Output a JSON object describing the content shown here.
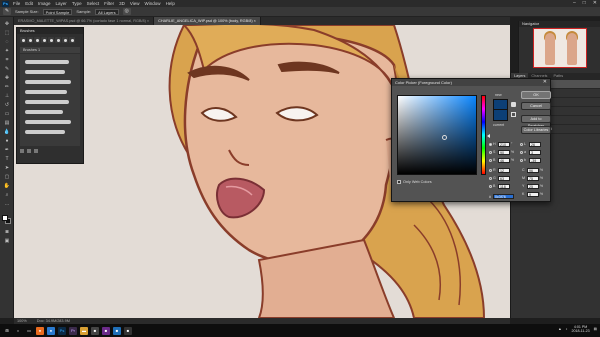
{
  "menubar": {
    "logo": "Ps",
    "items": [
      "File",
      "Edit",
      "Image",
      "Layer",
      "Type",
      "Select",
      "Filter",
      "3D",
      "View",
      "Window",
      "Help"
    ],
    "window_controls": [
      "–",
      "□",
      "✕"
    ]
  },
  "options_bar": {
    "tool_icon": "eyedropper-icon",
    "sample_size_label": "Sample Size:",
    "sample_size_value": "Point Sample",
    "sample_label": "Sample:",
    "sample_value": "All Layers"
  },
  "tabs": [
    {
      "label": "ERASMO_MALETTE_WIPAS.psd @ 66.7% (cortado fase 1 normal, RGB/8) ×",
      "active": false
    },
    {
      "label": "CHARLIE_ANGELICA_WIP.psd @ 100% (body, RGB/8) ×",
      "active": true
    }
  ],
  "brushes_panel": {
    "title": "Brushes",
    "folder_label": "Brushes 1"
  },
  "navigator": {
    "title": "Navigator"
  },
  "layers_panel": {
    "tabs": [
      "Layers",
      "Channels",
      "Paths"
    ],
    "layers": [
      {
        "name": "body",
        "selected": true
      },
      {
        "name": "hair",
        "selected": false
      },
      {
        "name": "lines",
        "selected": false
      },
      {
        "name": "colors",
        "selected": false
      },
      {
        "name": "sketch",
        "selected": false
      },
      {
        "name": "Background",
        "selected": false
      }
    ]
  },
  "color_picker": {
    "title": "Color Picker (Foreground Color)",
    "close_icon": "close-icon",
    "new_label": "new",
    "current_label": "current",
    "ok_label": "OK",
    "cancel_label": "Cancel",
    "add_swatches_label": "Add to Swatches",
    "libraries_label": "Color Libraries",
    "only_web_label": "Only Web Colors",
    "new_color": "#0c3f76",
    "fields": {
      "H": {
        "value": "210",
        "unit": "°",
        "checked": true
      },
      "S": {
        "value": "90",
        "unit": "%",
        "checked": false
      },
      "B": {
        "value": "46",
        "unit": "%",
        "checked": false
      },
      "R": {
        "value": "12",
        "unit": "",
        "checked": false
      },
      "G": {
        "value": "63",
        "unit": "",
        "checked": false
      },
      "Bl": {
        "value": "118",
        "unit": "",
        "checked": false
      },
      "L": {
        "value": "26",
        "unit": "",
        "checked": false
      },
      "a": {
        "value": "3",
        "unit": "",
        "checked": false
      },
      "b": {
        "value": "-39",
        "unit": "",
        "checked": false
      },
      "C": {
        "value": "96",
        "unit": "%",
        "checked": false
      },
      "M": {
        "value": "75",
        "unit": "%",
        "checked": false
      },
      "Y": {
        "value": "25",
        "unit": "%",
        "checked": false
      },
      "K": {
        "value": "9",
        "unit": "%",
        "checked": false
      }
    },
    "hex_label": "#",
    "hex_value": "0c3f76"
  },
  "status_bar": {
    "zoom": "100%",
    "doc_info": "Doc: 34.9M/283.9M"
  },
  "taskbar": {
    "start_icon": "windows-icon",
    "time": "4:01 PM",
    "date": "2018-11-23"
  },
  "colors": {
    "accent": "#31a8ff",
    "dialog_bg": "#535353",
    "canvas_bg": "#e3dcd6",
    "skin": "#e7b89c",
    "hair": "#d9a34e",
    "outline": "#8a3d2a",
    "lips": "#b85a62"
  }
}
